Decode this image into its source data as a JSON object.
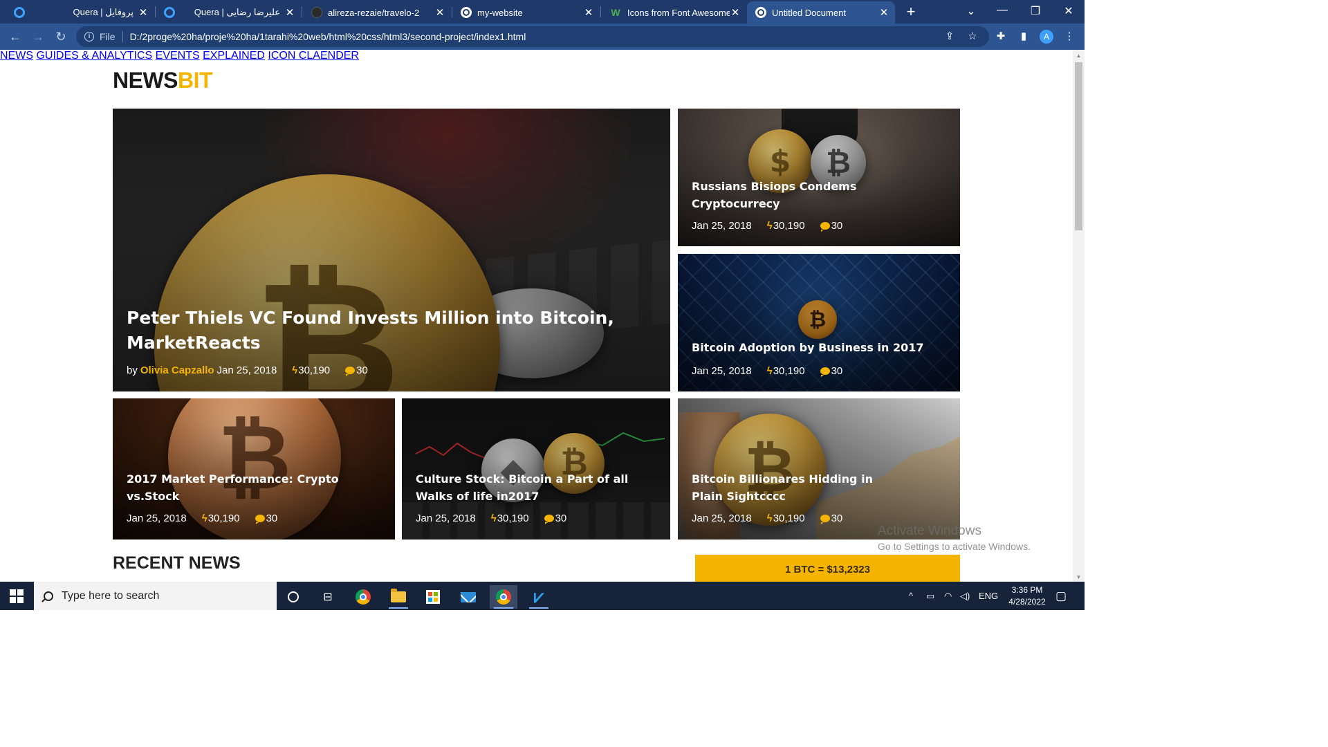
{
  "browser": {
    "tabs": [
      {
        "title": "Quera | پروفایل",
        "icon": "quera-icon"
      },
      {
        "title": "Quera | علیرضا رضایی",
        "icon": "quera-icon"
      },
      {
        "title": "alireza-rezaie/travelo-2",
        "icon": "github-icon"
      },
      {
        "title": "my-website",
        "icon": "globe-icon"
      },
      {
        "title": "Icons from Font Awesome,",
        "icon": "webflow-icon"
      },
      {
        "title": "Untitled Document",
        "icon": "globe-icon"
      }
    ],
    "new_tab_label": "+",
    "address": {
      "scheme": "File",
      "url": "D:/2proge%20ha/proje%20ha/1tarahi%20web/html%20css/html3/second-project/index1.html"
    },
    "profile_initial": "A"
  },
  "site": {
    "logo_part1": "NEWS",
    "logo_part2": "BIT",
    "nav": [
      "NEWS",
      "GUIDES & ANALYTICS",
      "EVENTS",
      "EXPLAINED",
      "ICON CLAENDER"
    ]
  },
  "featured": {
    "title": "Peter Thiels VC Found Invests Million into Bitcoin, MarketReacts",
    "by_label": "by",
    "author": "Olivia Capzallo",
    "date": "Jan 25, 2018",
    "views": "30,190",
    "comments": "30"
  },
  "side_cards": [
    {
      "title": "Russians Bisiops Condems Cryptocurrecy",
      "date": "Jan 25, 2018",
      "views": "30,190",
      "comments": "30"
    },
    {
      "title": "Bitcoin Adoption by Business in 2017",
      "date": "Jan 25, 2018",
      "views": "30,190",
      "comments": "30"
    }
  ],
  "bottom_cards": [
    {
      "title": "2017 Market Performance: Crypto vs.Stock",
      "date": "Jan 25, 2018",
      "views": "30,190",
      "comments": "30"
    },
    {
      "title": "Culture Stock: Bitcoin a Part of all Walks of life in2017",
      "date": "Jan 25, 2018",
      "views": "30,190",
      "comments": "30"
    },
    {
      "title": "Bitcoin Billionares Hidding in Plain Sightcccc",
      "date": "Jan 25, 2018",
      "views": "30,190",
      "comments": "30"
    }
  ],
  "recent_news_title": "RECENT NEWS",
  "btc_ticker": "1 BTC = $13,2323",
  "watermark": {
    "line1": "Activate Windows",
    "line2": "Go to Settings to activate Windows."
  },
  "taskbar": {
    "search_placeholder": "Type here to search",
    "language": "ENG",
    "time": "3:36 PM",
    "date": "4/28/2022"
  },
  "colors": {
    "accent": "#f5b400",
    "chrome": "#2d5591",
    "taskbar": "#16233a"
  }
}
